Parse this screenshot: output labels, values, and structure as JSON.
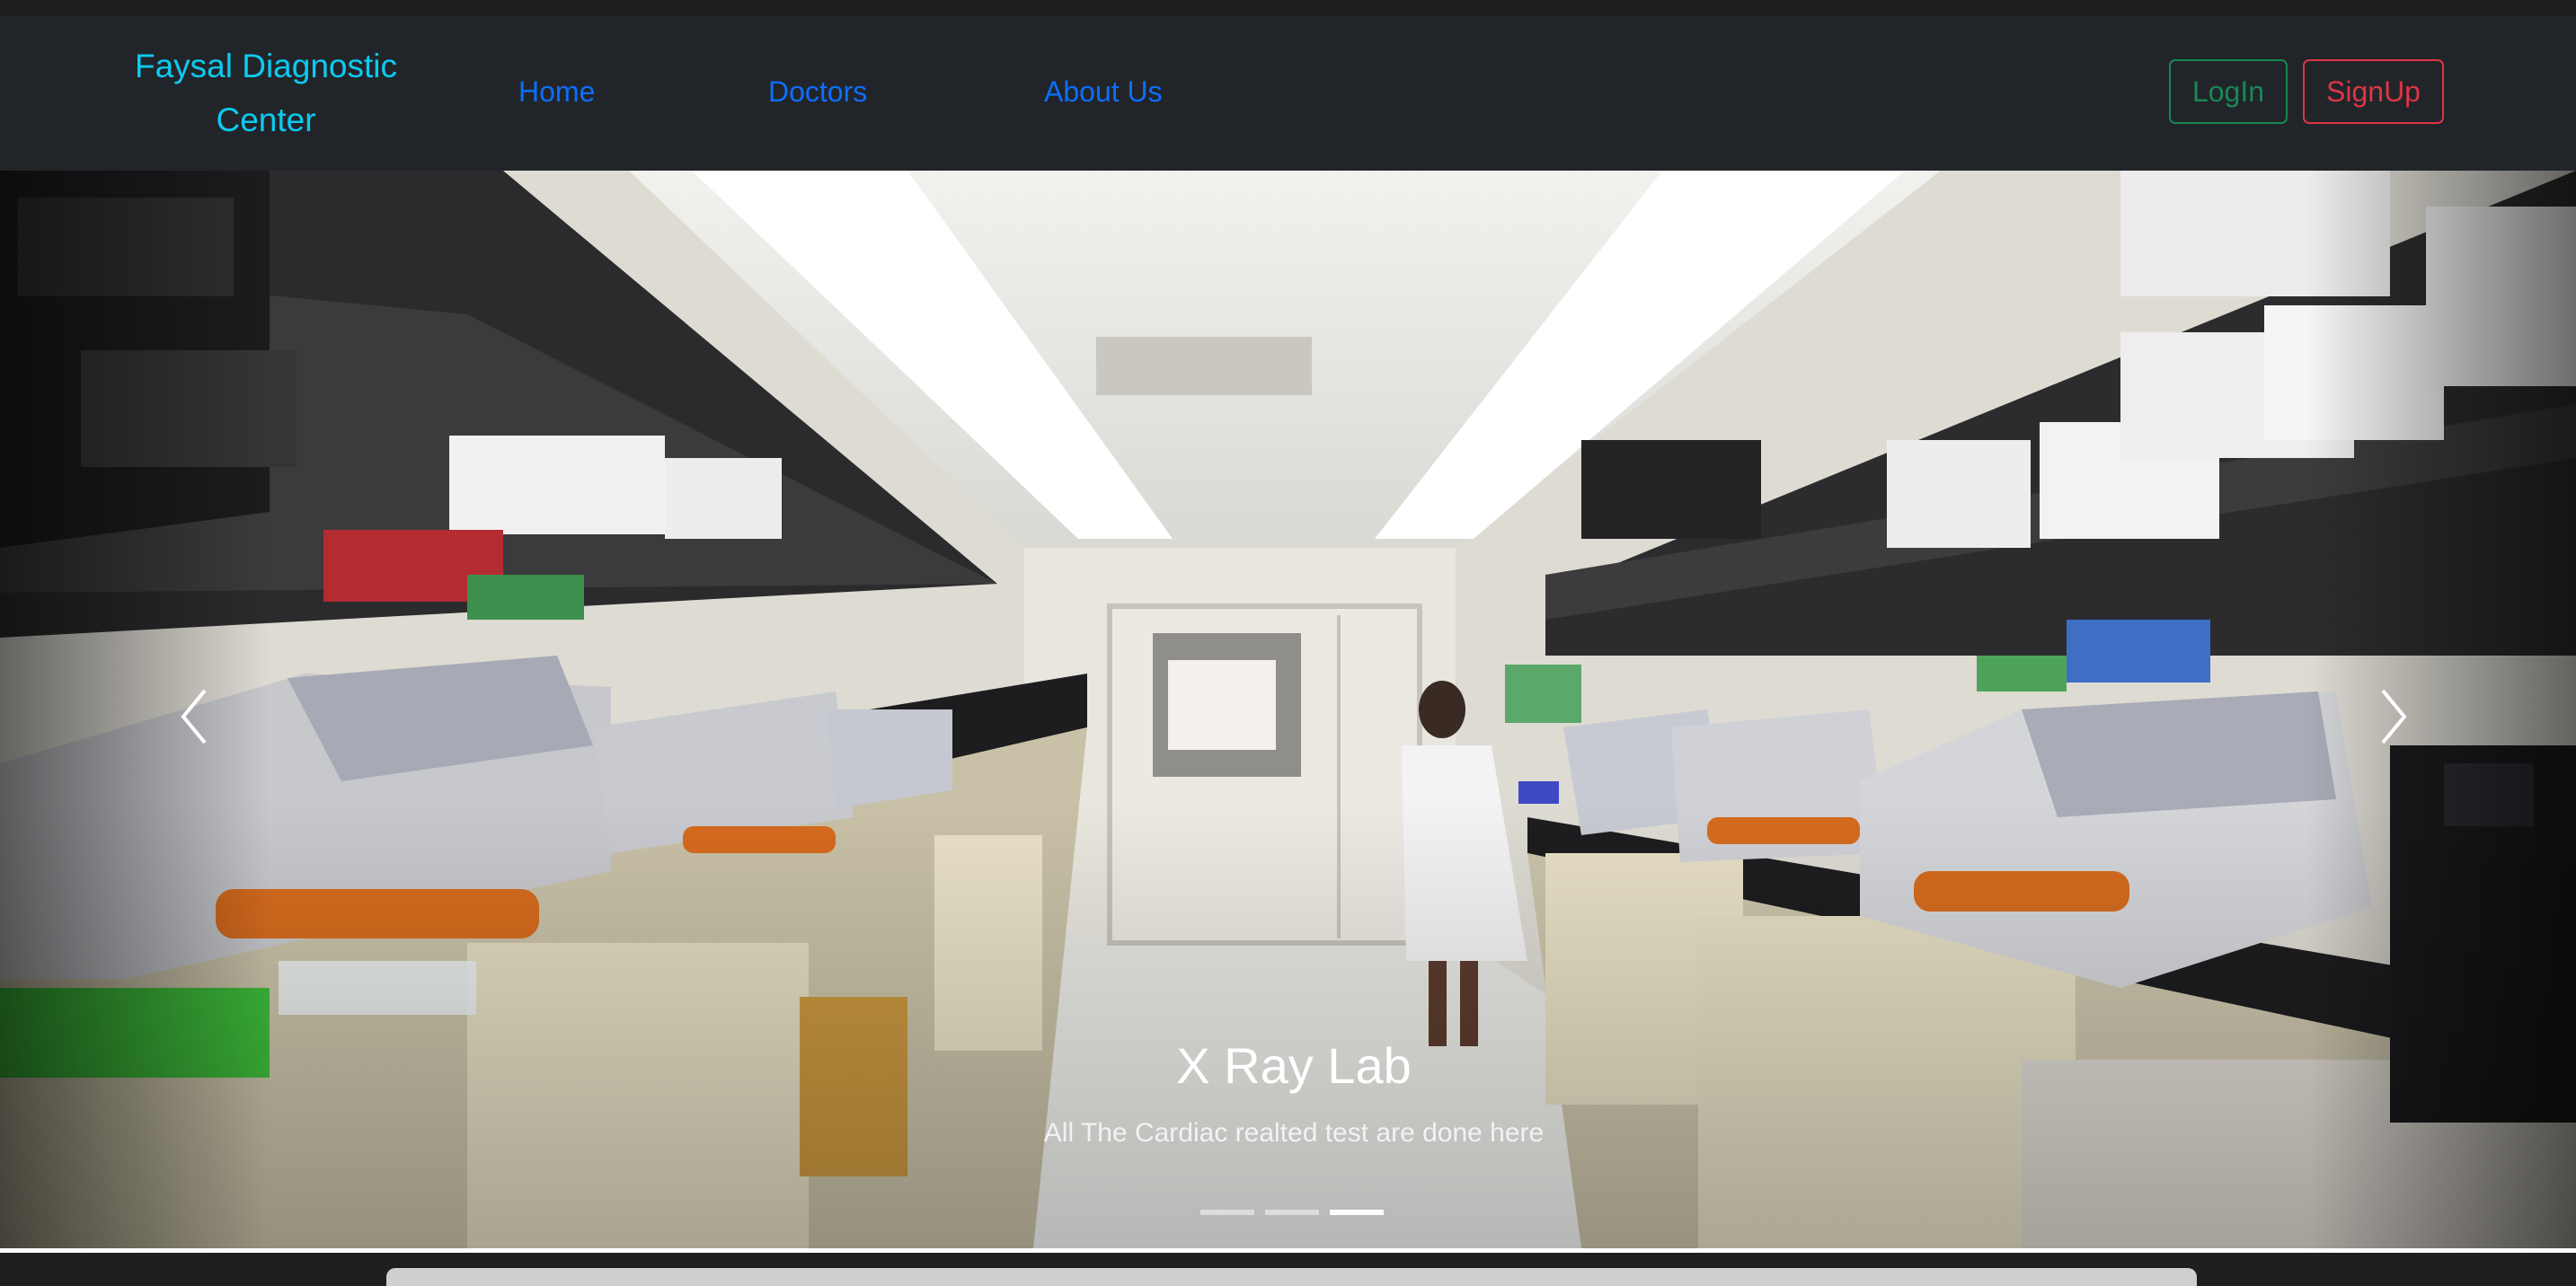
{
  "navbar": {
    "brand": "Faysal Diagnostic Center",
    "links": [
      {
        "label": "Home"
      },
      {
        "label": "Doctors"
      },
      {
        "label": "About Us"
      }
    ],
    "login_label": "LogIn",
    "signup_label": "SignUp"
  },
  "carousel": {
    "caption_title": "X Ray Lab",
    "caption_text": "All The Cardiac realted test are done here",
    "slide_count": 3,
    "active_slide": 3,
    "prev_icon": "chevron-left-icon",
    "next_icon": "chevron-right-icon"
  },
  "colors": {
    "navbar_bg": "#212529",
    "brand": "#0dcaf0",
    "link": "#0d6efd",
    "login": "#198754",
    "signup": "#dc3545"
  }
}
